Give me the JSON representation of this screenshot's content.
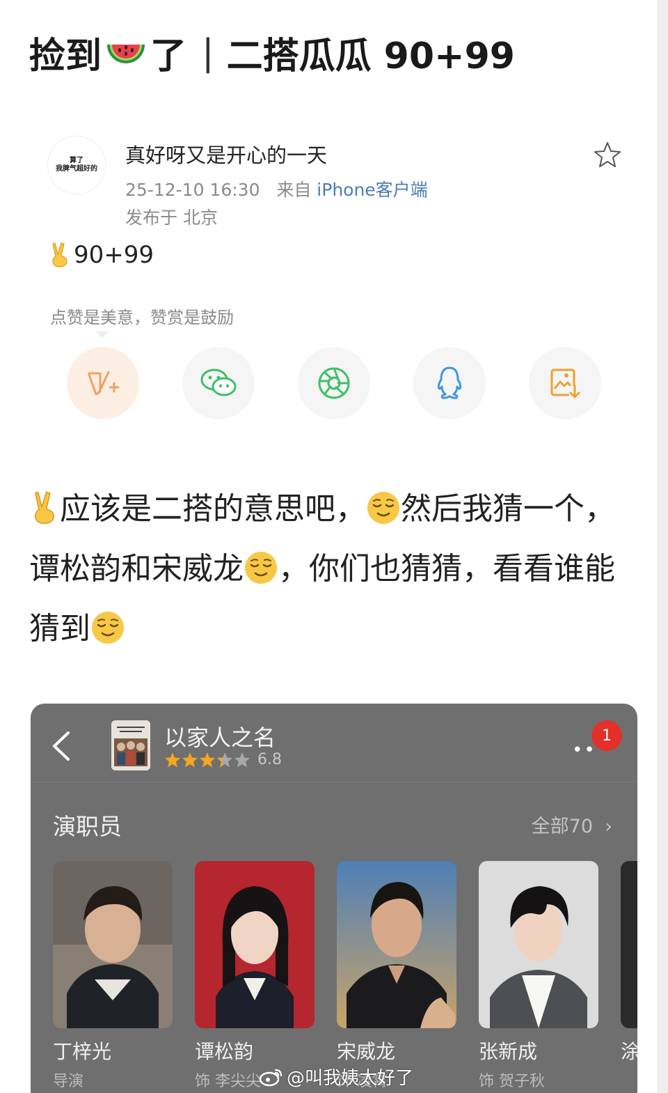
{
  "post": {
    "title_prefix": "捡到",
    "title_suffix": "了",
    "title_divider": "|",
    "title_main": "二搭瓜瓜 90+99",
    "title_emoji": "watermelon-emoji",
    "avatar_text_line1": "算了",
    "avatar_text_line2": "我脾气超好的",
    "username": "真好呀又是开心的一天",
    "timestamp": "25-12-10 16:30",
    "from_label": "来自",
    "source": "iPhone客户端",
    "location": "发布于 北京",
    "body": "90+99",
    "body_emoji": "victory-hand-emoji",
    "reward_hint": "点赞是美意，赞赏是鼓励"
  },
  "share": {
    "buttons": [
      {
        "name": "weibo-reward-icon",
        "color": "#f0a060"
      },
      {
        "name": "wechat-icon",
        "color": "#3fbf68"
      },
      {
        "name": "moments-icon",
        "color": "#3fbf68"
      },
      {
        "name": "qq-icon",
        "color": "#3e96e8"
      },
      {
        "name": "save-image-icon",
        "color": "#f0a030"
      }
    ]
  },
  "caption": {
    "line1_a": "应该是二搭的意思吧，",
    "line1_b": "然后我猜一个，",
    "line2_a": "谭松韵和宋威龙",
    "line2_b": "，你们也猜猜，看看谁能",
    "line3": "猜到"
  },
  "movie": {
    "title": "以家人之名",
    "rating": "6.8",
    "badge_count": "1",
    "section_title": "演职员",
    "see_all": "全部70",
    "cast": [
      {
        "name": "丁梓光",
        "role": "导演"
      },
      {
        "name": "谭松韵",
        "role": "饰 李尖尖"
      },
      {
        "name": "宋威龙",
        "role": "饰 凌霄"
      },
      {
        "name": "张新成",
        "role": "饰 贺子秋"
      },
      {
        "name": "涂",
        "role": ""
      }
    ]
  },
  "watermark": "@叫我姨太好了",
  "colors": {
    "accent_blue": "#4a7db8",
    "card_bg": "#6f6f6f",
    "badge_red": "#e3302a",
    "star_gold": "#f5a623"
  }
}
